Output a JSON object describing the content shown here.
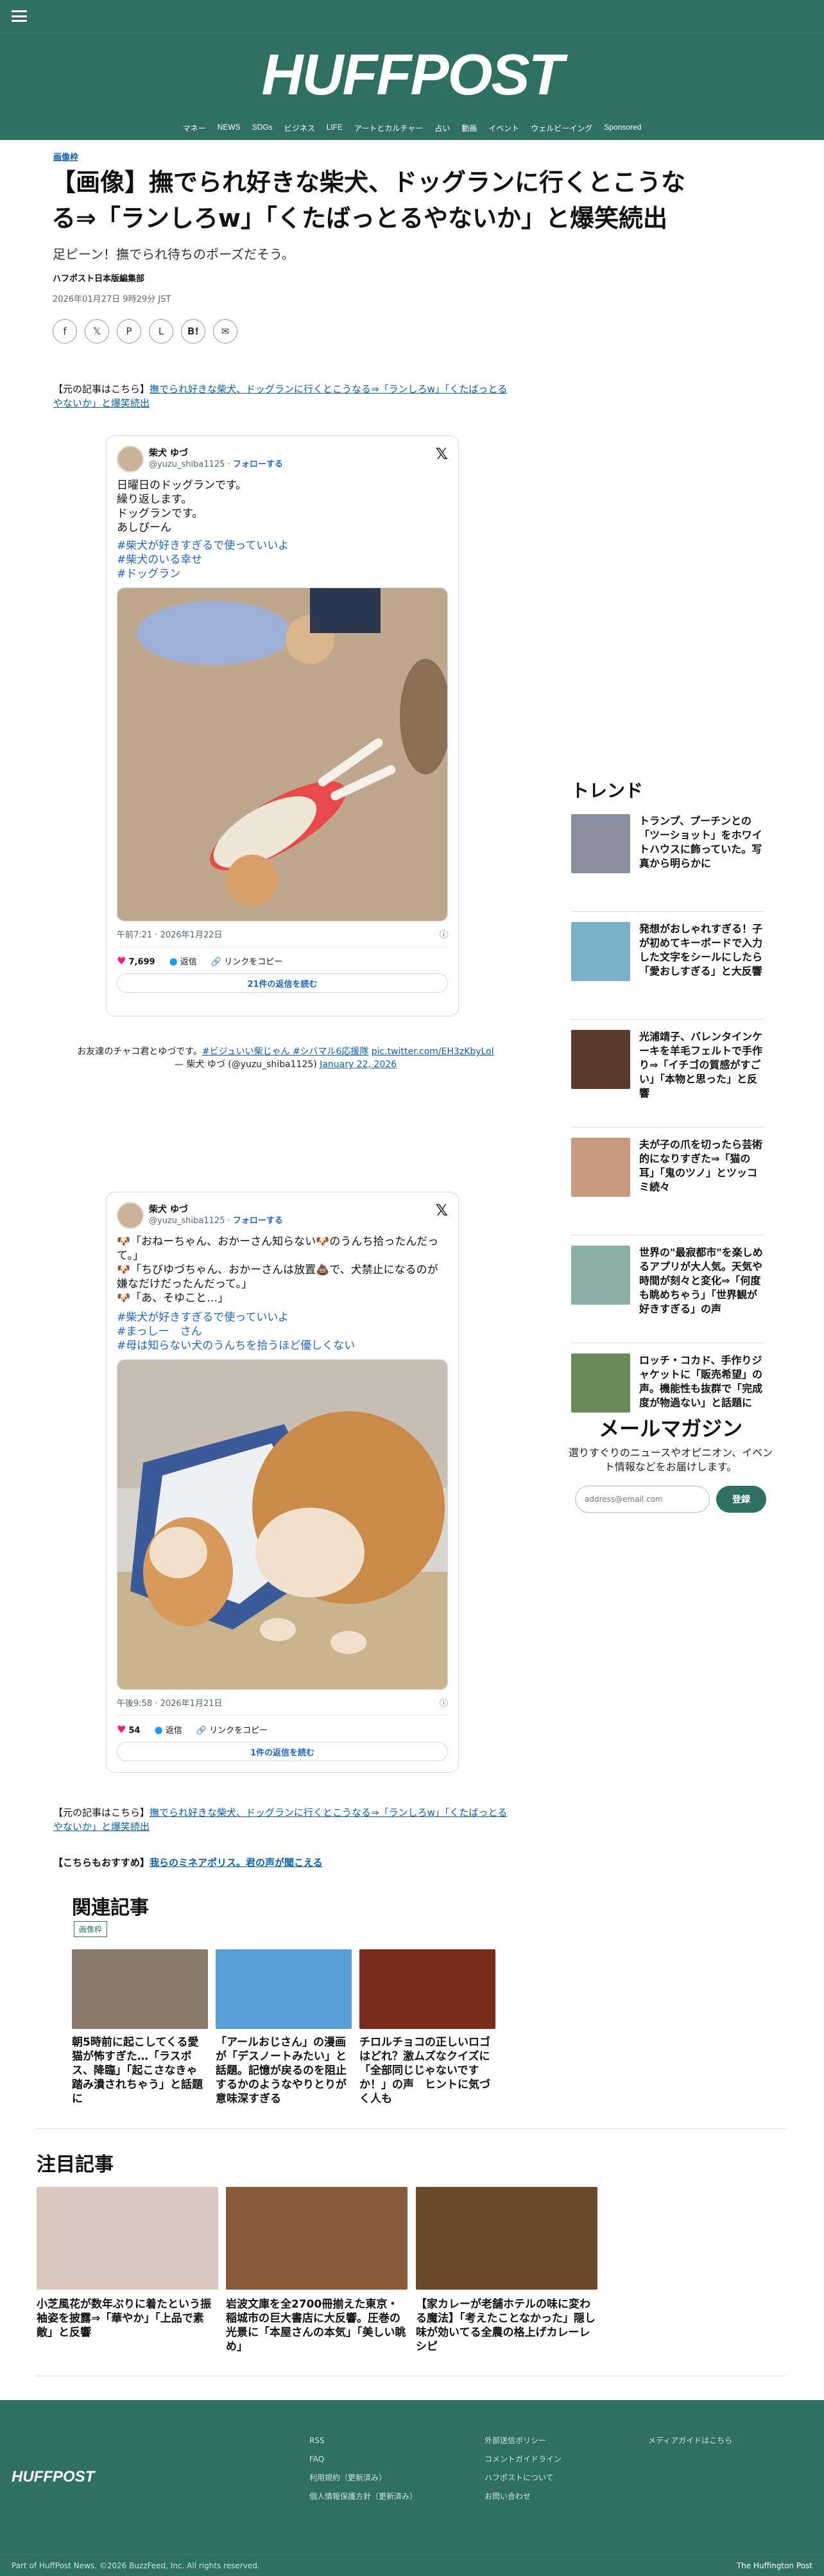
{
  "header": {
    "logo": "HUFFPOST",
    "nav": [
      "マネー",
      "NEWS",
      "SDGs",
      "ビジネス",
      "LIFE",
      "アートとカルチャー",
      "占い",
      "動画",
      "イベント",
      "ウェルビーイング",
      "Sponsored"
    ]
  },
  "article": {
    "section": "画像枠",
    "title": "【画像】撫でられ好きな柴犬、ドッグランに行くとこうなる⇒「ランしろw」「くたばっとるやないか」と爆笑続出",
    "subtitle": "足ピーン！撫でられ待ちのポーズだそう。",
    "byline": "ハフポスト日本版編集部",
    "date": "2026年01月27日 9時29分 JST",
    "share_icons": [
      "facebook-icon",
      "x-icon",
      "pinterest-icon",
      "line-icon",
      "hatena-icon",
      "email-icon"
    ],
    "source_prefix": "【元の記事はこちら】",
    "source_link": "撫でられ好きな柴犬、ドッグランに行くとこうなる⇒「ランしろw」「くたばっとるやないか」と爆笑続出",
    "recommend_prefix": "【こちらもおすすめ】",
    "recommend_link": "我らのミネアポリス。君の声が聞こえる"
  },
  "tweet1": {
    "name": "柴犬 ゆづ",
    "handle": "@yuzu_shiba1125",
    "follow": "フォローする",
    "text": "日曜日のドッグランです。\n繰り返します。\nドッグランです。\nあしぴーん",
    "tags": "#柴犬が好きすぎるで使っていいよ\n#柴犬のいる幸せ\n#ドッグラン",
    "time": "午前7:21 · 2026年1月22日",
    "likes": "7,699",
    "reply": "返信",
    "copy": "リンクをコピー",
    "read_replies": "21件の返信を読む"
  },
  "caption1": {
    "text": "お友達のチャコ君とゆづです。",
    "tags_link": "#ビジュいい柴じゃん #シバマル6応援隊",
    "pic_link": "pic.twitter.com/EH3zKbyLol",
    "author": "— 柴犬 ゆづ (@yuzu_shiba1125)",
    "date_link": "January 22, 2026"
  },
  "tweet2": {
    "name": "柴犬 ゆづ",
    "handle": "@yuzu_shiba1125",
    "follow": "フォローする",
    "text": "🐶「おねーちゃん、おかーさん知らない🐶のうんち拾ったんだって。」\n🐶「ちびゆづちゃん、おかーさんは放置💩で、犬禁止になるのが嫌なだけだったんだって。」\n🐶「あ、そゆこと…」",
    "tags": "#柴犬が好きすぎるで使っていいよ\n#まっしー　さん\n#母は知らない犬のうんちを拾うほど優しくない",
    "time": "午後9:58 · 2026年1月21日",
    "likes": "54",
    "reply": "返信",
    "copy": "リンクをコピー",
    "read_replies": "1件の返信を読む"
  },
  "sidebar": {
    "trend_title": "トレンド",
    "trends": [
      {
        "text": "トランプ、プーチンとの「ツーショット」をホワイトハウスに飾っていた。写真から明らかに",
        "color": "#8a8fa0"
      },
      {
        "text": "発想がおしゃれすぎる！子が初めてキーボードで入力した文字をシールにしたら「愛おしすぎる」と大反響",
        "color": "#7ab0c8"
      },
      {
        "text": "光浦靖子、バレンタインケーキを羊毛フェルトで手作り⇒「イチゴの質感がすごい」「本物と思った」と反響",
        "color": "#5a3a2a"
      },
      {
        "text": "夫が子の爪を切ったら芸術的になりすぎた⇒「猫の耳」「鬼のツノ」とツッコミ続々",
        "color": "#c89a80"
      },
      {
        "text": "世界の\"最寂都市\"を楽しめるアプリが大人気。天気や時間が刻々と変化⇒「何度も眺めちゃう」「世界観が好きすぎる」の声",
        "color": "#8ab0a8"
      },
      {
        "text": "ロッチ・コカド、手作りジャケットに「販売希望」の声。機能性も抜群で「完成度が物過ない」と話題に",
        "color": "#6a8a5a"
      }
    ],
    "mail_title": "メールマガジン",
    "mail_text": "選りすぐりのニュースやオピニオン、イベント情報などをお届けします。",
    "mail_placeholder": "address@email.com",
    "mail_button": "登録"
  },
  "related": {
    "title": "関連記事",
    "badge": "画像枠",
    "items": [
      {
        "text": "朝5時前に起こしてくる愛猫が怖すぎた…「ラスボス、降臨」「起こさなきゃ踏み潰されちゃう」と話題に",
        "color": "#8a7a6a"
      },
      {
        "text": "「アールおじさん」の漫画が「デスノートみたい」と話題。記憶が戻るのを阻止するかのようなやりとりが意味深すぎる",
        "color": "#5aa0d8"
      },
      {
        "text": "チロルチョコの正しいロゴはどれ？激ムズなクイズに「全部同じじゃないですか！」の声　ヒントに気づく人も",
        "color": "#7a2a1a"
      }
    ]
  },
  "featured": {
    "title": "注目記事",
    "items": [
      {
        "text": "小芝風花が数年ぶりに着たという振袖姿を披露⇒「華やか」「上品で素敵」と反響",
        "color": "#d8c8c0"
      },
      {
        "text": "岩波文庫を全2700冊揃えた東京・稲城市の巨大書店に大反響。圧巻の光景に「本屋さんの本気」「美しい眺め」",
        "color": "#8a5a3a"
      },
      {
        "text": "【家カレーが老舗ホテルの味に変わる魔法】「考えたことなかった」隠し味が効いてる全農の格上げカレーレシピ",
        "color": "#6a4a2a"
      }
    ]
  },
  "footer": {
    "logo": "HUFFPOST",
    "col1": [
      "RSS",
      "FAQ",
      "利用規約（更新済み）",
      "個人情報保護方針（更新済み）"
    ],
    "col2": [
      "外部送信ポリシー",
      "コメントガイドライン",
      "ハフポストについて",
      "お問い合わせ"
    ],
    "col3": [
      "メディアガイドはこちら"
    ],
    "copyright": "Part of HuffPost News. ©2026 BuzzFeed, Inc. All rights reserved.",
    "brand": "The Huffington Post"
  }
}
